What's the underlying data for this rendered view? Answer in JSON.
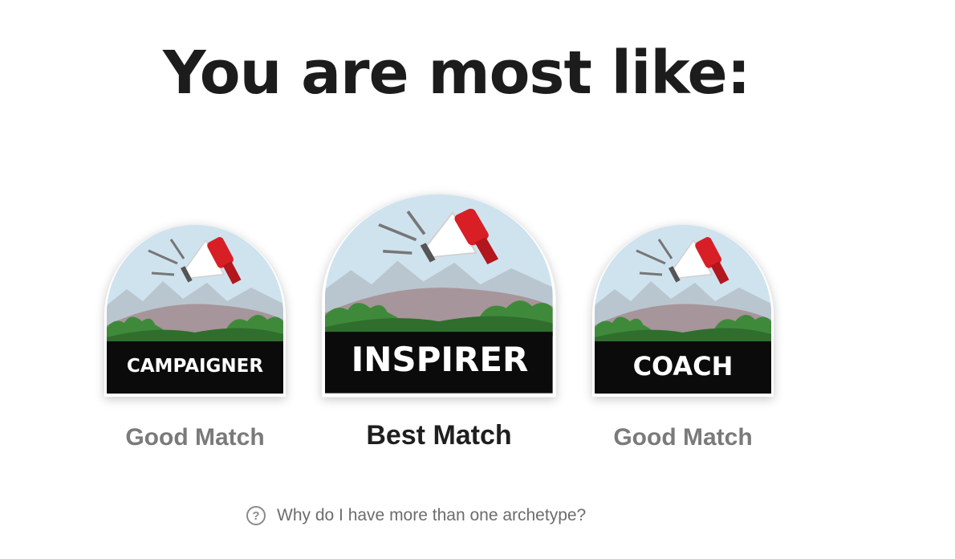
{
  "page": {
    "title": "You are most like:"
  },
  "archetypes": [
    {
      "name": "CAMPAIGNER",
      "match": "Good Match",
      "rank": "secondary"
    },
    {
      "name": "INSPIRER",
      "match": "Best Match",
      "rank": "primary"
    },
    {
      "name": "COACH",
      "match": "Good Match",
      "rank": "secondary"
    }
  ],
  "help": {
    "icon": "question-circle-icon",
    "icon_glyph": "?",
    "text": "Why do I have more than one archetype?"
  },
  "colors": {
    "title": "#1c1c1c",
    "sky": "#cfe3ef",
    "mountain": "#b9c6cf",
    "hill": "#a6959a",
    "foliage": "#3f8a3a",
    "banner": "#0b0b0b",
    "megaphone_red": "#d81f26",
    "good_match": "#7a7a7a",
    "best_match": "#1f1f1f"
  }
}
